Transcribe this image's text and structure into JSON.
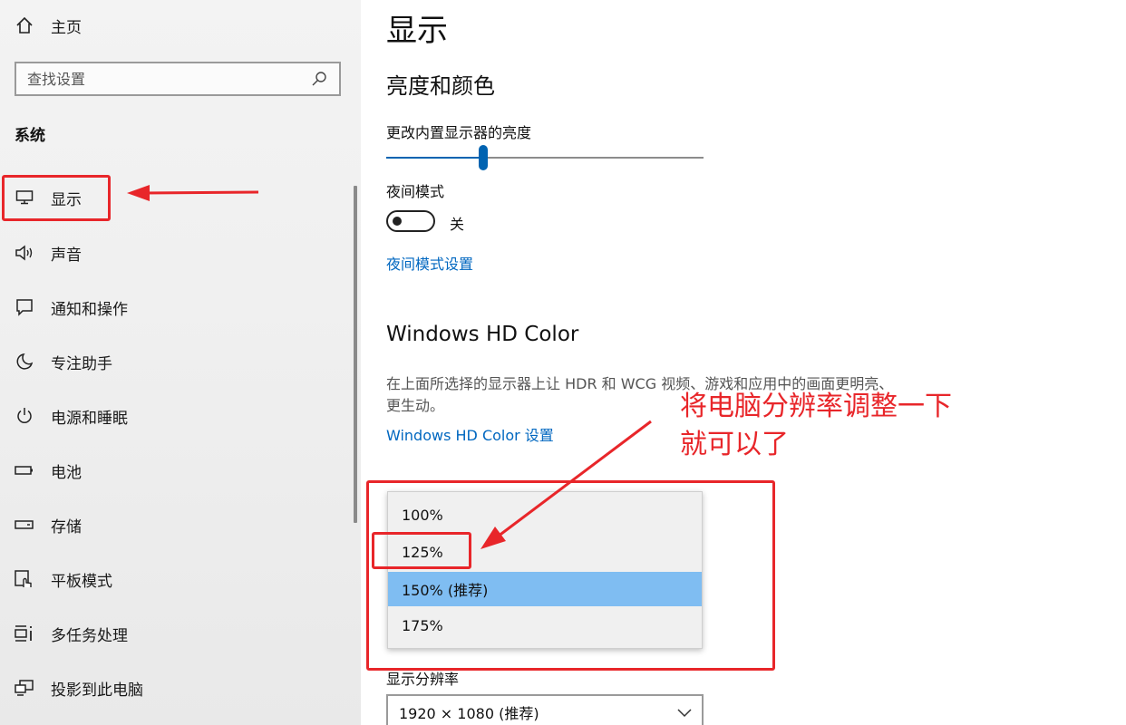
{
  "sidebar": {
    "home": {
      "label": "主页",
      "icon": "home-icon"
    },
    "search": {
      "placeholder": "查找设置",
      "icon": "search-icon"
    },
    "section_title": "系统",
    "items": [
      {
        "label": "显示",
        "icon": "monitor-icon"
      },
      {
        "label": "声音",
        "icon": "speaker-icon"
      },
      {
        "label": "通知和操作",
        "icon": "notification-icon"
      },
      {
        "label": "专注助手",
        "icon": "moon-icon"
      },
      {
        "label": "电源和睡眠",
        "icon": "power-icon"
      },
      {
        "label": "电池",
        "icon": "battery-icon"
      },
      {
        "label": "存储",
        "icon": "storage-icon"
      },
      {
        "label": "平板模式",
        "icon": "tablet-mode-icon"
      },
      {
        "label": "多任务处理",
        "icon": "multitasking-icon"
      },
      {
        "label": "投影到此电脑",
        "icon": "project-icon"
      }
    ]
  },
  "main": {
    "title": "显示",
    "brightness_section": "亮度和颜色",
    "brightness_label": "更改内置显示器的亮度",
    "brightness_value": 0.305,
    "night_mode_label": "夜间模式",
    "night_mode_state": "关",
    "night_mode_link": "夜间模式设置",
    "hd_section": "Windows HD Color",
    "hd_description": "在上面所选择的显示器上让 HDR 和 WCG 视频、游戏和应用中的画面更明亮、更生动。",
    "hd_link": "Windows HD Color 设置",
    "scale_options": [
      "100%",
      "125%",
      "150% (推荐)",
      "175%"
    ],
    "scale_selected": "150% (推荐)",
    "resolution_label": "显示分辨率",
    "resolution_value": "1920 × 1080 (推荐)"
  },
  "annotation": {
    "text": "将电脑分辨率调整一下就可以了",
    "color": "#e8262a"
  },
  "colors": {
    "accent": "#0063b1",
    "link": "#0067c0",
    "selected_option": "#7fbdf2"
  }
}
